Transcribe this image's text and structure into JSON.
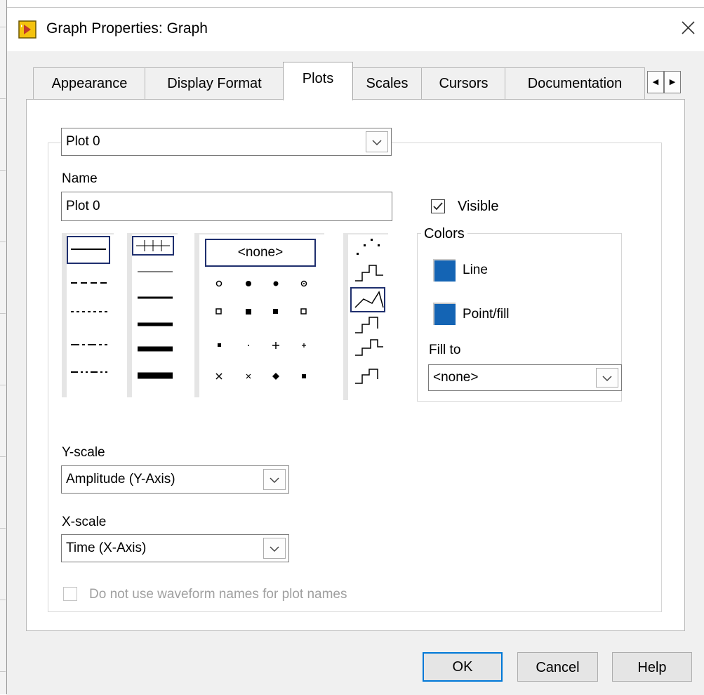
{
  "window": {
    "title": "Graph Properties: Graph",
    "icon": "labview-vi-icon",
    "close_icon": "close-icon"
  },
  "tabs": [
    {
      "label": "Appearance",
      "selected": false
    },
    {
      "label": "Display Format",
      "selected": false
    },
    {
      "label": "Plots",
      "selected": true
    },
    {
      "label": "Scales",
      "selected": false
    },
    {
      "label": "Cursors",
      "selected": false
    },
    {
      "label": "Documentation",
      "selected": false
    }
  ],
  "tab_scroll": {
    "left_icon": "arrow-left-icon",
    "right_icon": "arrow-right-icon"
  },
  "plots": {
    "plot_selector": "Plot 0",
    "name_label": "Name",
    "name_value": "Plot 0",
    "visible_label": "Visible",
    "visible_checked": true,
    "point_style_selected": "<none>",
    "colors": {
      "title": "Colors",
      "line_label": "Line",
      "line_color": "#1464b4",
      "point_fill_label": "Point/fill",
      "point_fill_color": "#1464b4"
    },
    "fill_to_label": "Fill to",
    "fill_to_value": "<none>",
    "yscale_label": "Y-scale",
    "yscale_value": "Amplitude (Y-Axis)",
    "xscale_label": "X-scale",
    "xscale_value": "Time (X-Axis)",
    "waveform_names_label": "Do not use waveform names for plot names",
    "waveform_names_checked": false
  },
  "buttons": {
    "ok": "OK",
    "cancel": "Cancel",
    "help": "Help"
  }
}
